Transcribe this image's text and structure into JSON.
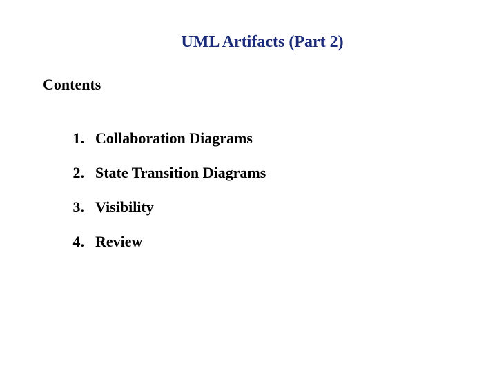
{
  "title": "UML Artifacts  (Part 2)",
  "contents_label": "Contents",
  "items": [
    {
      "num": "1.",
      "label": "Collaboration Diagrams"
    },
    {
      "num": "2.",
      "label": "State Transition Diagrams"
    },
    {
      "num": "3.",
      "label": "Visibility"
    },
    {
      "num": "4.",
      "label": "Review"
    }
  ]
}
